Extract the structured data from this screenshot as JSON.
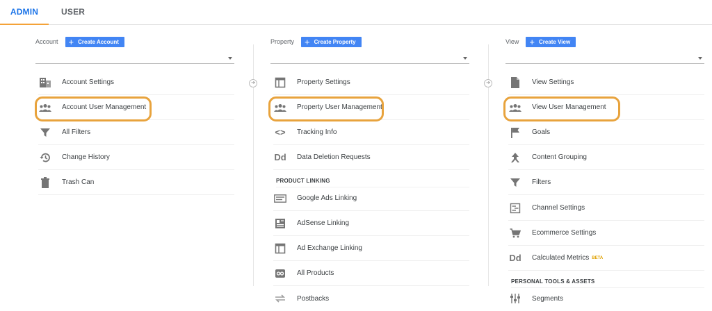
{
  "tabs": {
    "admin": "ADMIN",
    "user": "USER"
  },
  "account": {
    "label": "Account",
    "create_button": "Create Account",
    "items": [
      {
        "label": "Account Settings",
        "icon": "building-icon"
      },
      {
        "label": "Account User Management",
        "icon": "people-icon"
      },
      {
        "label": "All Filters",
        "icon": "filter-icon"
      },
      {
        "label": "Change History",
        "icon": "history-icon"
      },
      {
        "label": "Trash Can",
        "icon": "trash-icon"
      }
    ]
  },
  "property": {
    "label": "Property",
    "create_button": "Create Property",
    "items": [
      {
        "label": "Property Settings",
        "icon": "window-icon"
      },
      {
        "label": "Property User Management",
        "icon": "people-icon"
      },
      {
        "label": "Tracking Info",
        "icon": "code-icon"
      },
      {
        "label": "Data Deletion Requests",
        "icon": "dd-icon"
      }
    ],
    "section_title": "PRODUCT LINKING",
    "linking_items": [
      {
        "label": "Google Ads Linking",
        "icon": "ads-icon"
      },
      {
        "label": "AdSense Linking",
        "icon": "adsense-icon"
      },
      {
        "label": "Ad Exchange Linking",
        "icon": "window-icon"
      },
      {
        "label": "All Products",
        "icon": "link-icon"
      },
      {
        "label": "Postbacks",
        "icon": "postback-icon"
      }
    ]
  },
  "view": {
    "label": "View",
    "create_button": "Create View",
    "items": [
      {
        "label": "View Settings",
        "icon": "document-icon"
      },
      {
        "label": "View User Management",
        "icon": "people-icon"
      },
      {
        "label": "Goals",
        "icon": "flag-icon"
      },
      {
        "label": "Content Grouping",
        "icon": "grouping-icon"
      },
      {
        "label": "Filters",
        "icon": "filter-icon"
      },
      {
        "label": "Channel Settings",
        "icon": "channel-icon"
      },
      {
        "label": "Ecommerce Settings",
        "icon": "cart-icon"
      },
      {
        "label": "Calculated Metrics",
        "icon": "dd-icon",
        "badge": "BETA"
      }
    ],
    "section_title": "PERSONAL TOOLS & ASSETS",
    "tools_items": [
      {
        "label": "Segments",
        "icon": "segments-icon"
      }
    ]
  },
  "colors": {
    "accent": "#4285f4",
    "highlight": "#e8a33d",
    "tab_underline": "#f4a237"
  }
}
